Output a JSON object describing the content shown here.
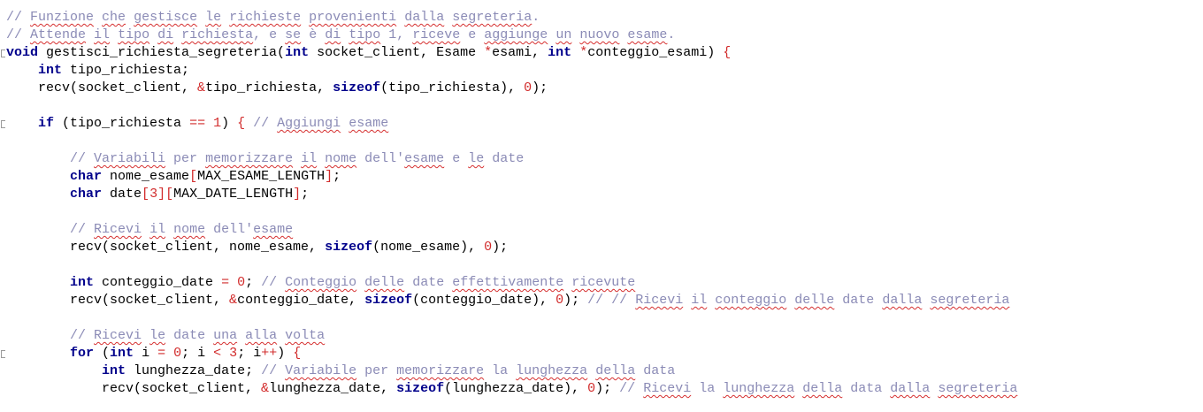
{
  "editor": {
    "language": "c",
    "colors": {
      "keyword": "#00008b",
      "comment": "#8b8bb6",
      "operator": "#d22c2c",
      "number": "#d22c2c",
      "spellcheck_squiggle": "#d63030"
    },
    "lines": [
      {
        "tokens": [
          {
            "t": "cm",
            "v": "// "
          },
          {
            "t": "cm",
            "v": "Funzione",
            "sq": true
          },
          {
            "t": "cm",
            "v": " "
          },
          {
            "t": "cm",
            "v": "che",
            "sq": true
          },
          {
            "t": "cm",
            "v": " "
          },
          {
            "t": "cm",
            "v": "gestisce",
            "sq": true
          },
          {
            "t": "cm",
            "v": " "
          },
          {
            "t": "cm",
            "v": "le",
            "sq": true
          },
          {
            "t": "cm",
            "v": " "
          },
          {
            "t": "cm",
            "v": "richieste",
            "sq": true
          },
          {
            "t": "cm",
            "v": " "
          },
          {
            "t": "cm",
            "v": "provenienti",
            "sq": true
          },
          {
            "t": "cm",
            "v": " "
          },
          {
            "t": "cm",
            "v": "dalla",
            "sq": true
          },
          {
            "t": "cm",
            "v": " "
          },
          {
            "t": "cm",
            "v": "segreteria",
            "sq": true
          },
          {
            "t": "cm",
            "v": "."
          }
        ]
      },
      {
        "tokens": [
          {
            "t": "cm",
            "v": "// "
          },
          {
            "t": "cm",
            "v": "Attende",
            "sq": true
          },
          {
            "t": "cm",
            "v": " "
          },
          {
            "t": "cm",
            "v": "il",
            "sq": true
          },
          {
            "t": "cm",
            "v": " "
          },
          {
            "t": "cm",
            "v": "tipo",
            "sq": true
          },
          {
            "t": "cm",
            "v": " "
          },
          {
            "t": "cm",
            "v": "di",
            "sq": true
          },
          {
            "t": "cm",
            "v": " "
          },
          {
            "t": "cm",
            "v": "richiesta",
            "sq": true
          },
          {
            "t": "cm",
            "v": ", e "
          },
          {
            "t": "cm",
            "v": "se",
            "sq": true
          },
          {
            "t": "cm",
            "v": " è "
          },
          {
            "t": "cm",
            "v": "di",
            "sq": true
          },
          {
            "t": "cm",
            "v": " "
          },
          {
            "t": "cm",
            "v": "tipo",
            "sq": true
          },
          {
            "t": "cm",
            "v": " 1, "
          },
          {
            "t": "cm",
            "v": "riceve",
            "sq": true
          },
          {
            "t": "cm",
            "v": " e "
          },
          {
            "t": "cm",
            "v": "aggiunge",
            "sq": true
          },
          {
            "t": "cm",
            "v": " "
          },
          {
            "t": "cm",
            "v": "un",
            "sq": true
          },
          {
            "t": "cm",
            "v": " "
          },
          {
            "t": "cm",
            "v": "nuovo",
            "sq": true
          },
          {
            "t": "cm",
            "v": " "
          },
          {
            "t": "cm",
            "v": "esame",
            "sq": true
          },
          {
            "t": "cm",
            "v": "."
          }
        ]
      },
      {
        "fold": true,
        "tokens": [
          {
            "t": "kw",
            "v": "void"
          },
          {
            "v": " gestisci_richiesta_segreteria("
          },
          {
            "t": "kw",
            "v": "int"
          },
          {
            "v": " socket_client, Esame "
          },
          {
            "t": "op",
            "v": "*"
          },
          {
            "v": "esami, "
          },
          {
            "t": "kw",
            "v": "int"
          },
          {
            "v": " "
          },
          {
            "t": "op",
            "v": "*"
          },
          {
            "v": "conteggio_esami) "
          },
          {
            "t": "op",
            "v": "{"
          }
        ]
      },
      {
        "tokens": [
          {
            "v": "    "
          },
          {
            "t": "kw",
            "v": "int"
          },
          {
            "v": " tipo_richiesta;"
          }
        ]
      },
      {
        "tokens": [
          {
            "v": "    recv(socket_client, "
          },
          {
            "t": "op",
            "v": "&"
          },
          {
            "v": "tipo_richiesta, "
          },
          {
            "t": "kw",
            "v": "sizeof"
          },
          {
            "v": "(tipo_richiesta), "
          },
          {
            "t": "num",
            "v": "0"
          },
          {
            "v": ");"
          }
        ]
      },
      {
        "tokens": []
      },
      {
        "fold": true,
        "tokens": [
          {
            "v": "    "
          },
          {
            "t": "kw",
            "v": "if"
          },
          {
            "v": " (tipo_richiesta "
          },
          {
            "t": "op",
            "v": "=="
          },
          {
            "v": " "
          },
          {
            "t": "num",
            "v": "1"
          },
          {
            "v": ") "
          },
          {
            "t": "op",
            "v": "{"
          },
          {
            "v": " "
          },
          {
            "t": "cm",
            "v": "// "
          },
          {
            "t": "cm",
            "v": "Aggiungi",
            "sq": true
          },
          {
            "t": "cm",
            "v": " "
          },
          {
            "t": "cm",
            "v": "esame",
            "sq": true
          }
        ]
      },
      {
        "tokens": []
      },
      {
        "tokens": [
          {
            "v": "        "
          },
          {
            "t": "cm",
            "v": "// "
          },
          {
            "t": "cm",
            "v": "Variabili",
            "sq": true
          },
          {
            "t": "cm",
            "v": " per "
          },
          {
            "t": "cm",
            "v": "memorizzare",
            "sq": true
          },
          {
            "t": "cm",
            "v": " "
          },
          {
            "t": "cm",
            "v": "il",
            "sq": true
          },
          {
            "t": "cm",
            "v": " "
          },
          {
            "t": "cm",
            "v": "nome",
            "sq": true
          },
          {
            "t": "cm",
            "v": " dell'"
          },
          {
            "t": "cm",
            "v": "esame",
            "sq": true
          },
          {
            "t": "cm",
            "v": " e "
          },
          {
            "t": "cm",
            "v": "le",
            "sq": true
          },
          {
            "t": "cm",
            "v": " date"
          }
        ]
      },
      {
        "tokens": [
          {
            "v": "        "
          },
          {
            "t": "kw",
            "v": "char"
          },
          {
            "v": " nome_esame"
          },
          {
            "t": "op",
            "v": "["
          },
          {
            "v": "MAX_ESAME_LENGTH"
          },
          {
            "t": "op",
            "v": "]"
          },
          {
            "v": ";"
          }
        ]
      },
      {
        "tokens": [
          {
            "v": "        "
          },
          {
            "t": "kw",
            "v": "char"
          },
          {
            "v": " date"
          },
          {
            "t": "op",
            "v": "["
          },
          {
            "t": "num",
            "v": "3"
          },
          {
            "t": "op",
            "v": "]["
          },
          {
            "v": "MAX_DATE_LENGTH"
          },
          {
            "t": "op",
            "v": "]"
          },
          {
            "v": ";"
          }
        ]
      },
      {
        "tokens": []
      },
      {
        "tokens": [
          {
            "v": "        "
          },
          {
            "t": "cm",
            "v": "// "
          },
          {
            "t": "cm",
            "v": "Ricevi",
            "sq": true
          },
          {
            "t": "cm",
            "v": " "
          },
          {
            "t": "cm",
            "v": "il",
            "sq": true
          },
          {
            "t": "cm",
            "v": " "
          },
          {
            "t": "cm",
            "v": "nome",
            "sq": true
          },
          {
            "t": "cm",
            "v": " dell'"
          },
          {
            "t": "cm",
            "v": "esame",
            "sq": true
          }
        ]
      },
      {
        "tokens": [
          {
            "v": "        recv(socket_client, nome_esame, "
          },
          {
            "t": "kw",
            "v": "sizeof"
          },
          {
            "v": "(nome_esame), "
          },
          {
            "t": "num",
            "v": "0"
          },
          {
            "v": ");"
          }
        ]
      },
      {
        "tokens": []
      },
      {
        "tokens": [
          {
            "v": "        "
          },
          {
            "t": "kw",
            "v": "int"
          },
          {
            "v": " conteggio_date "
          },
          {
            "t": "op",
            "v": "="
          },
          {
            "v": " "
          },
          {
            "t": "num",
            "v": "0"
          },
          {
            "v": "; "
          },
          {
            "t": "cm",
            "v": "// "
          },
          {
            "t": "cm",
            "v": "Conteggio",
            "sq": true
          },
          {
            "t": "cm",
            "v": " "
          },
          {
            "t": "cm",
            "v": "delle",
            "sq": true
          },
          {
            "t": "cm",
            "v": " date "
          },
          {
            "t": "cm",
            "v": "effettivamente",
            "sq": true
          },
          {
            "t": "cm",
            "v": " "
          },
          {
            "t": "cm",
            "v": "ricevute",
            "sq": true
          }
        ]
      },
      {
        "tokens": [
          {
            "v": "        recv(socket_client, "
          },
          {
            "t": "op",
            "v": "&"
          },
          {
            "v": "conteggio_date, "
          },
          {
            "t": "kw",
            "v": "sizeof"
          },
          {
            "v": "(conteggio_date), "
          },
          {
            "t": "num",
            "v": "0"
          },
          {
            "v": "); "
          },
          {
            "t": "cm",
            "v": "// // "
          },
          {
            "t": "cm",
            "v": "Ricevi",
            "sq": true
          },
          {
            "t": "cm",
            "v": " "
          },
          {
            "t": "cm",
            "v": "il",
            "sq": true
          },
          {
            "t": "cm",
            "v": " "
          },
          {
            "t": "cm",
            "v": "conteggio",
            "sq": true
          },
          {
            "t": "cm",
            "v": " "
          },
          {
            "t": "cm",
            "v": "delle",
            "sq": true
          },
          {
            "t": "cm",
            "v": " date "
          },
          {
            "t": "cm",
            "v": "dalla",
            "sq": true
          },
          {
            "t": "cm",
            "v": " "
          },
          {
            "t": "cm",
            "v": "segreteria",
            "sq": true
          }
        ]
      },
      {
        "tokens": []
      },
      {
        "tokens": [
          {
            "v": "        "
          },
          {
            "t": "cm",
            "v": "// "
          },
          {
            "t": "cm",
            "v": "Ricevi",
            "sq": true
          },
          {
            "t": "cm",
            "v": " "
          },
          {
            "t": "cm",
            "v": "le",
            "sq": true
          },
          {
            "t": "cm",
            "v": " date "
          },
          {
            "t": "cm",
            "v": "una",
            "sq": true
          },
          {
            "t": "cm",
            "v": " "
          },
          {
            "t": "cm",
            "v": "alla",
            "sq": true
          },
          {
            "t": "cm",
            "v": " "
          },
          {
            "t": "cm",
            "v": "volta",
            "sq": true
          }
        ]
      },
      {
        "fold": true,
        "tokens": [
          {
            "v": "        "
          },
          {
            "t": "kw",
            "v": "for"
          },
          {
            "v": " ("
          },
          {
            "t": "kw",
            "v": "int"
          },
          {
            "v": " i "
          },
          {
            "t": "op",
            "v": "="
          },
          {
            "v": " "
          },
          {
            "t": "num",
            "v": "0"
          },
          {
            "v": "; i "
          },
          {
            "t": "op",
            "v": "<"
          },
          {
            "v": " "
          },
          {
            "t": "num",
            "v": "3"
          },
          {
            "v": "; i"
          },
          {
            "t": "op",
            "v": "++"
          },
          {
            "v": ") "
          },
          {
            "t": "op",
            "v": "{"
          }
        ]
      },
      {
        "tokens": [
          {
            "v": "            "
          },
          {
            "t": "kw",
            "v": "int"
          },
          {
            "v": " lunghezza_date; "
          },
          {
            "t": "cm",
            "v": "// "
          },
          {
            "t": "cm",
            "v": "Variabile",
            "sq": true
          },
          {
            "t": "cm",
            "v": " per "
          },
          {
            "t": "cm",
            "v": "memorizzare",
            "sq": true
          },
          {
            "t": "cm",
            "v": " la "
          },
          {
            "t": "cm",
            "v": "lunghezza",
            "sq": true
          },
          {
            "t": "cm",
            "v": " "
          },
          {
            "t": "cm",
            "v": "della",
            "sq": true
          },
          {
            "t": "cm",
            "v": " data"
          }
        ]
      },
      {
        "tokens": [
          {
            "v": "            recv(socket_client, "
          },
          {
            "t": "op",
            "v": "&"
          },
          {
            "v": "lunghezza_date, "
          },
          {
            "t": "kw",
            "v": "sizeof"
          },
          {
            "v": "(lunghezza_date), "
          },
          {
            "t": "num",
            "v": "0"
          },
          {
            "v": "); "
          },
          {
            "t": "cm",
            "v": "// "
          },
          {
            "t": "cm",
            "v": "Ricevi",
            "sq": true
          },
          {
            "t": "cm",
            "v": " la "
          },
          {
            "t": "cm",
            "v": "lunghezza",
            "sq": true
          },
          {
            "t": "cm",
            "v": " "
          },
          {
            "t": "cm",
            "v": "della",
            "sq": true
          },
          {
            "t": "cm",
            "v": " data "
          },
          {
            "t": "cm",
            "v": "dalla",
            "sq": true
          },
          {
            "t": "cm",
            "v": " "
          },
          {
            "t": "cm",
            "v": "segreteria",
            "sq": true
          }
        ]
      }
    ]
  }
}
